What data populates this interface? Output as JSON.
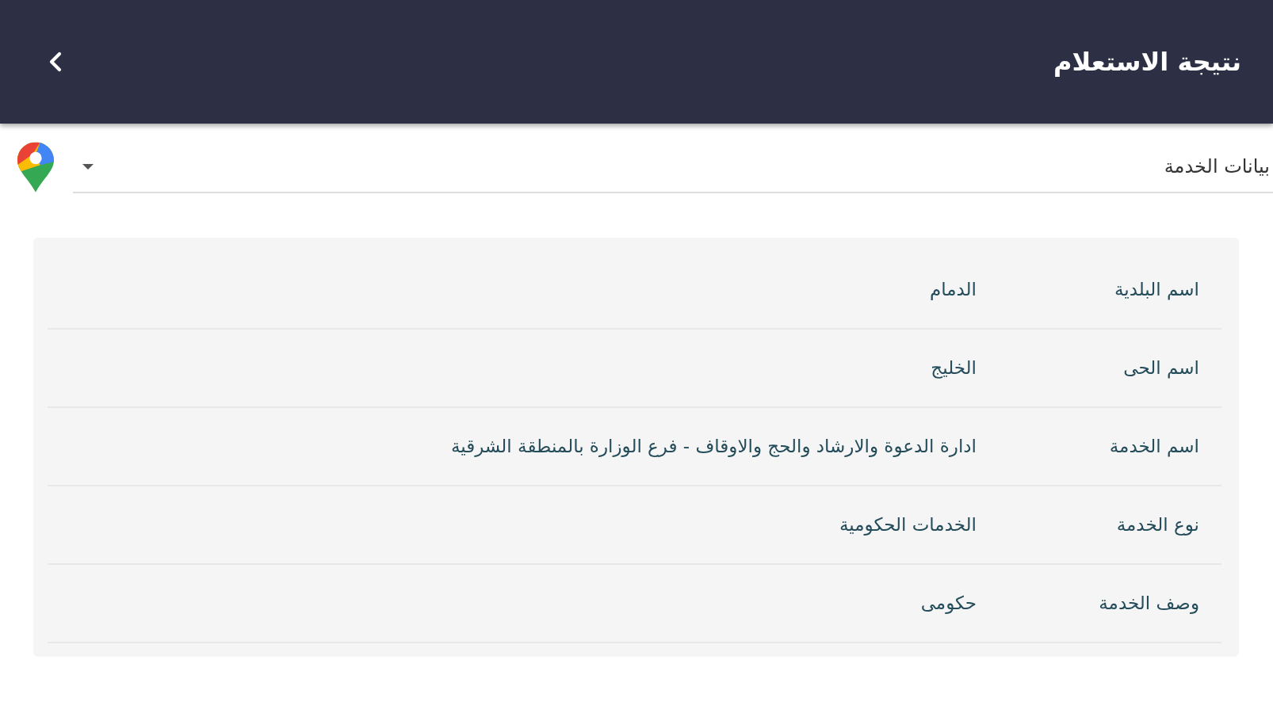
{
  "header": {
    "title": "نتيجة الاستعلام"
  },
  "dropdown": {
    "value": "بيانات الخدمة"
  },
  "details": {
    "rows": [
      {
        "label": "اسم البلدية",
        "value": "الدمام"
      },
      {
        "label": "اسم الحى",
        "value": "الخليج"
      },
      {
        "label": "اسم الخدمة",
        "value": "ادارة الدعوة والارشاد والحج والاوقاف - فرع الوزارة بالمنطقة الشرقية"
      },
      {
        "label": "نوع الخدمة",
        "value": "الخدمات الحكومية"
      },
      {
        "label": "وصف الخدمة",
        "value": "حكومى"
      }
    ]
  }
}
